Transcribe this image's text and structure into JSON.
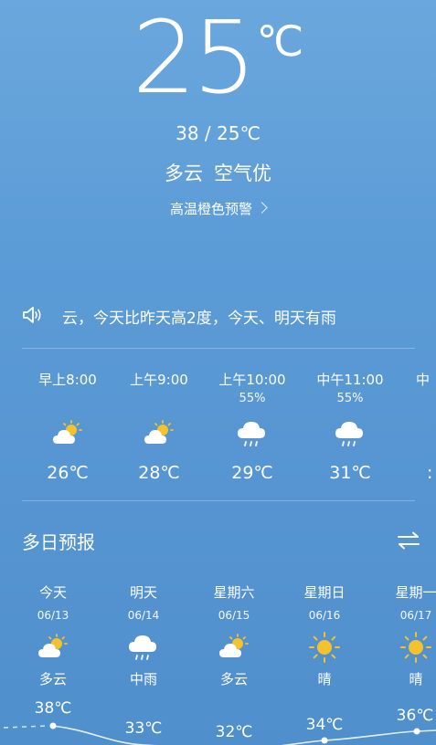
{
  "current": {
    "temp": "25",
    "unit": "℃",
    "range": "38 / 25℃",
    "condition": "多云",
    "air": "空气优",
    "alert": "高温橙色预警"
  },
  "ticker": {
    "text": "云，今天比昨天高2度，今天、明天有雨",
    "icon": "speaker-icon"
  },
  "hourly": [
    {
      "time": "早上8:00",
      "precip": "",
      "icon": "partly-cloudy-icon",
      "temp": "26℃"
    },
    {
      "time": "上午9:00",
      "precip": "",
      "icon": "partly-cloudy-icon",
      "temp": "28℃"
    },
    {
      "time": "上午10:00",
      "precip": "55%",
      "icon": "rain-icon",
      "temp": "29℃"
    },
    {
      "time": "中午11:00",
      "precip": "55%",
      "icon": "rain-icon",
      "temp": "31℃"
    },
    {
      "time": "中",
      "precip": "",
      "icon": "",
      "temp": ":"
    }
  ],
  "forecast": {
    "title": "多日预报",
    "toggle_icon": "swap-icon",
    "days": [
      {
        "name": "今天",
        "date": "06/13",
        "icon": "partly-cloudy-icon",
        "cond": "多云",
        "high": "38℃",
        "high_value": 38
      },
      {
        "name": "明天",
        "date": "06/14",
        "icon": "rain-icon",
        "cond": "中雨",
        "high": "33℃",
        "high_value": 33
      },
      {
        "name": "星期六",
        "date": "06/15",
        "icon": "partly-cloudy-icon",
        "cond": "多云",
        "high": "32℃",
        "high_value": 32
      },
      {
        "name": "星期日",
        "date": "06/16",
        "icon": "sunny-icon",
        "cond": "晴",
        "high": "34℃",
        "high_value": 34
      },
      {
        "name": "星期一",
        "date": "06/17",
        "icon": "sunny-icon",
        "cond": "晴",
        "high": "36℃",
        "high_value": 36
      }
    ]
  },
  "colors": {
    "sun": "#f6c22c",
    "cloud": "#ffffff"
  }
}
